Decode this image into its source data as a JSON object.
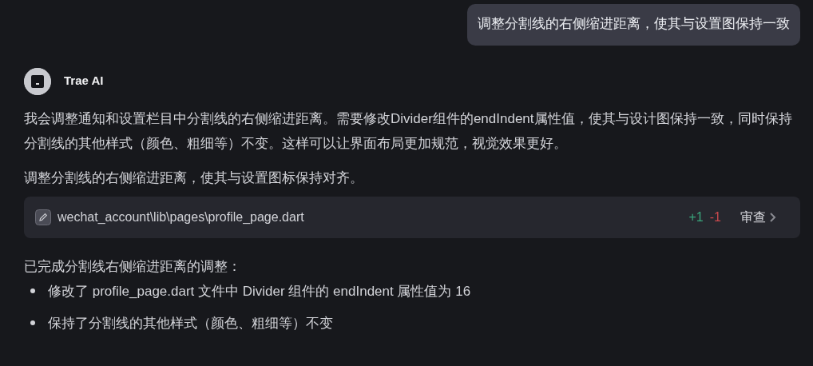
{
  "user_message": {
    "text": "调整分割线的右侧缩进距离，使其与设置图保持一致"
  },
  "assistant": {
    "name": "Trae AI",
    "paragraphs": [
      "我会调整通知和设置栏目中分割线的右侧缩进距离。需要修改Divider组件的endIndent属性值，使其与设计图保持一致，同时保持分割线的其他样式（颜色、粗细等）不变。这样可以让界面布局更加规范，视觉效果更好。",
      "调整分割线的右侧缩进距离，使其与设置图标保持对齐。"
    ],
    "file_change": {
      "path": "wechat_account\\lib\\pages\\profile_page.dart",
      "added": "+1",
      "removed": "-1",
      "review_label": "审查"
    },
    "summary": "已完成分割线右侧缩进距离的调整：",
    "bullets": [
      "修改了 profile_page.dart 文件中 Divider 组件的 endIndent 属性值为 16",
      "保持了分割线的其他样式（颜色、粗细等）不变"
    ]
  }
}
